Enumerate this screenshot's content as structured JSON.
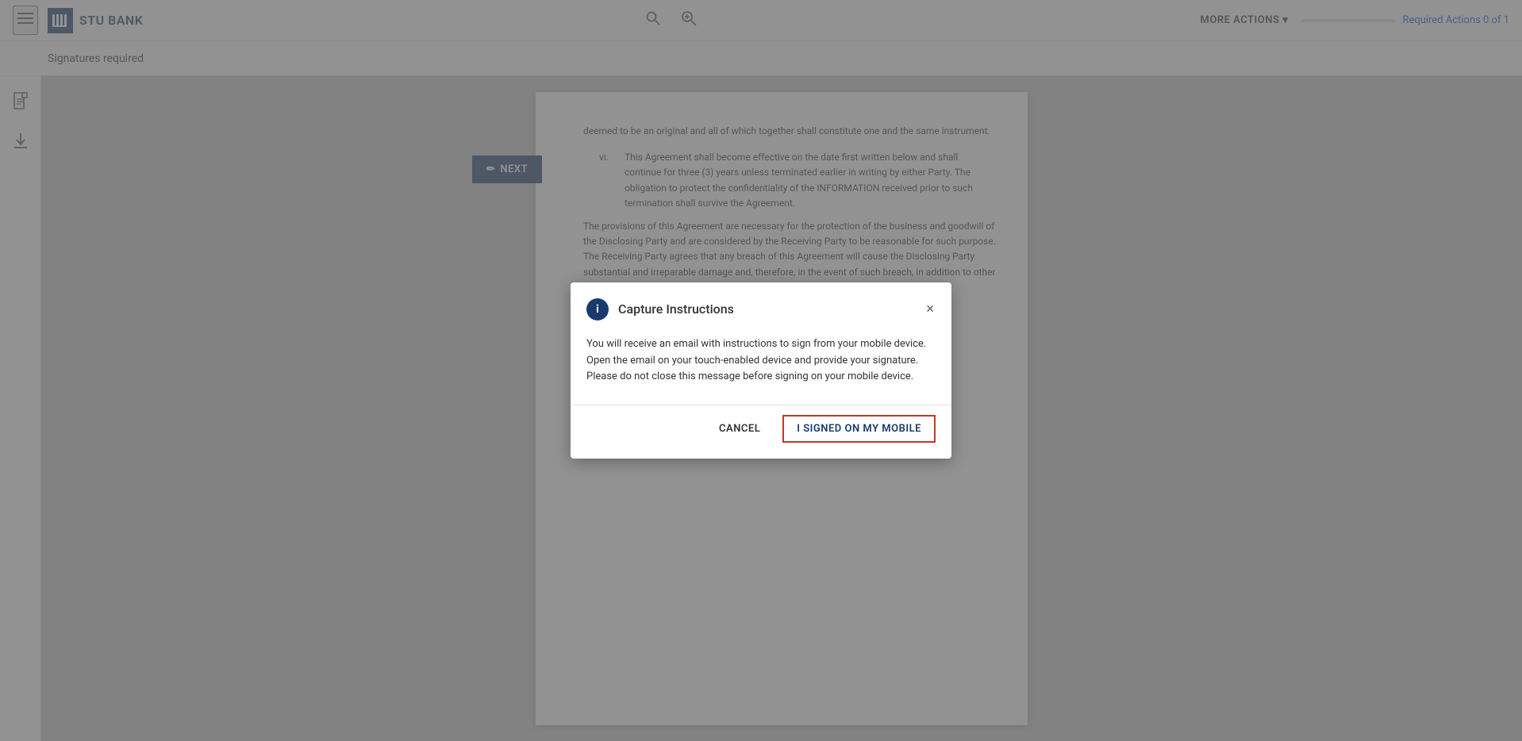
{
  "header": {
    "menu_label": "Menu",
    "logo_text": "STU BANK",
    "search1_label": "Search",
    "search2_label": "Search zoom",
    "more_actions_label": "MORE ACTIONS",
    "chevron_label": "chevron down",
    "required_actions_text": "Required Actions 0 of 1",
    "progress_percent": 0
  },
  "sub_header": {
    "title": "Signatures required"
  },
  "sidebar": {
    "doc_icon_label": "document-icon",
    "download_icon_label": "download-icon"
  },
  "next_button": {
    "label": "NEXT",
    "icon": "pencil-icon"
  },
  "document": {
    "section_vi_label": "vi.",
    "section_vi_text": "This Agreement shall become effective on the date first written below and shall continue for three (3) years unless terminated earlier in writing by either Party. The obligation to protect the confidentiality of the INFORMATION received prior to such termination shall survive the Agreement.",
    "paragraph_text": "The provisions of this Agreement are necessary for the protection of the business and goodwill of the Disclosing Party and are considered by the Receiving Party to be reasonable for such purpose. The Receiving Party agrees that any breach of this Agreement will cause the Disclosing Party substantial and irreparable damage and, therefore, in the event of such breach, in addition to other remedies that may be",
    "top_text": "deemed to be an original and all of which together shall constitute one and the same instrument."
  },
  "modal": {
    "title": "Capture Instructions",
    "info_icon": "i",
    "close_icon": "×",
    "line1": "You will receive an email with instructions to sign from your mobile device.",
    "line2": "Open the email on your touch-enabled device and provide your signature.",
    "line3": "Please do not close this message before signing on your mobile device.",
    "cancel_label": "CANCEL",
    "signed_label": "I SIGNED ON MY MOBILE"
  }
}
